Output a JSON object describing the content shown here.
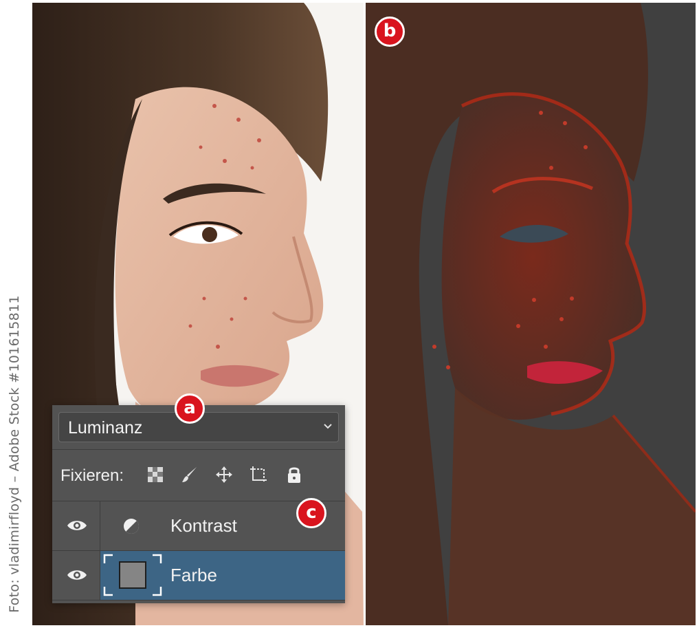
{
  "photo_credit": "Foto: vladimirfloyd – Adobe Stock #101615811",
  "badges": {
    "a": "a",
    "b": "b",
    "c": "c"
  },
  "layers_panel": {
    "blend_mode": "Luminanz",
    "lock_label": "Fixieren:",
    "lock_icons": [
      "transparency-lock-icon",
      "brush-lock-icon",
      "move-lock-icon",
      "artboard-lock-icon",
      "lock-all-icon"
    ],
    "layers": [
      {
        "name": "Kontrast",
        "thumbnail": "adjustment-icon",
        "visible": true,
        "selected": false
      },
      {
        "name": "Farbe",
        "thumbnail": "gray-fill-thumbnail",
        "visible": true,
        "selected": true
      }
    ]
  },
  "colors": {
    "badge": "#d9141e",
    "panel_bg": "#535353",
    "selected_row": "#3d6585",
    "right_bg": "#3f3f3f",
    "overlay_red": "#b02a16"
  }
}
